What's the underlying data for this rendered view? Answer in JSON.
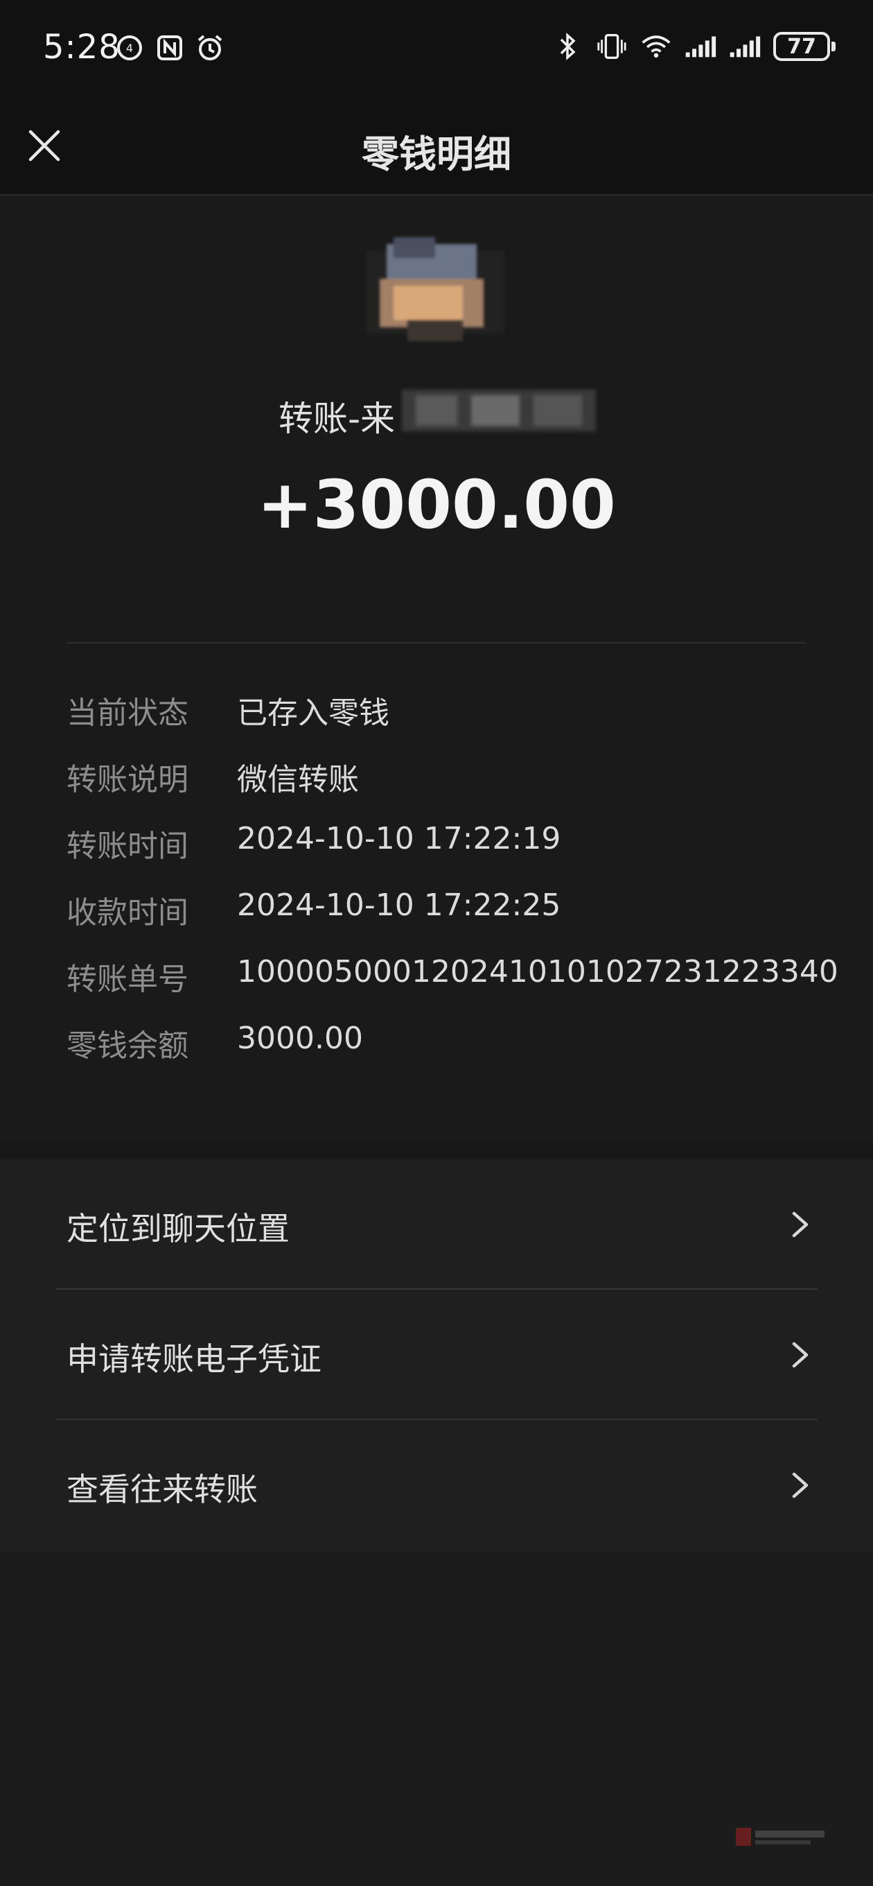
{
  "status_bar": {
    "time": "5:28",
    "left_icons": [
      "data-sync-icon",
      "nfc-icon",
      "alarm-icon"
    ],
    "right_icons": [
      "bluetooth-icon",
      "vibrate-icon",
      "wifi-icon",
      "signal-icon",
      "signal-icon"
    ],
    "battery": "77"
  },
  "header": {
    "title": "零钱明细"
  },
  "summary": {
    "payer": "转账-来",
    "amount": "+3000.00"
  },
  "details": [
    {
      "label": "当前状态",
      "value": "已存入零钱"
    },
    {
      "label": "转账说明",
      "value": "微信转账"
    },
    {
      "label": "转账时间",
      "value": "2024-10-10 17:22:19"
    },
    {
      "label": "收款时间",
      "value": "2024-10-10 17:22:25"
    },
    {
      "label": "转账单号",
      "value": "1000050001202410101027231223340"
    },
    {
      "label": "零钱余额",
      "value": "3000.00"
    }
  ],
  "actions": [
    {
      "label": "定位到聊天位置"
    },
    {
      "label": "申请转账电子凭证"
    },
    {
      "label": "查看往来转账"
    }
  ],
  "colors": {
    "background": "#1a1a1a",
    "header": "#111111",
    "label": "#8d8d8d",
    "value": "#dcdcdc"
  }
}
